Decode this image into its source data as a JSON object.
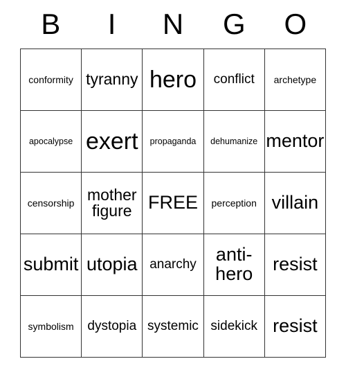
{
  "card": {
    "type": "bingo-card",
    "columns": 5,
    "rows": 5,
    "border_color": "#333333",
    "background_color": "#ffffff",
    "text_color": "#000000"
  },
  "header": {
    "letters": [
      "B",
      "I",
      "N",
      "G",
      "O"
    ]
  },
  "grid": {
    "cells": [
      {
        "text": "conformity",
        "size": "fs-s"
      },
      {
        "text": "tyranny",
        "size": "fs-l"
      },
      {
        "text": "hero",
        "size": "fs-xxl"
      },
      {
        "text": "conflict",
        "size": "fs-m"
      },
      {
        "text": "archetype",
        "size": "fs-s"
      },
      {
        "text": "apocalypse",
        "size": "fs-xs"
      },
      {
        "text": "exert",
        "size": "fs-xxl"
      },
      {
        "text": "propaganda",
        "size": "fs-xs"
      },
      {
        "text": "dehumanize",
        "size": "fs-xs"
      },
      {
        "text": "mentor",
        "size": "fs-xl"
      },
      {
        "text": "censorship",
        "size": "fs-s"
      },
      {
        "text": "mother\nfigure",
        "size": "fs-l"
      },
      {
        "text": "FREE",
        "size": "fs-xl"
      },
      {
        "text": "perception",
        "size": "fs-s"
      },
      {
        "text": "villain",
        "size": "fs-xl"
      },
      {
        "text": "submit",
        "size": "fs-xl"
      },
      {
        "text": "utopia",
        "size": "fs-xl"
      },
      {
        "text": "anarchy",
        "size": "fs-m"
      },
      {
        "text": "anti-\nhero",
        "size": "fs-xl"
      },
      {
        "text": "resist",
        "size": "fs-xl"
      },
      {
        "text": "symbolism",
        "size": "fs-s"
      },
      {
        "text": "dystopia",
        "size": "fs-m"
      },
      {
        "text": "systemic",
        "size": "fs-m"
      },
      {
        "text": "sidekick",
        "size": "fs-m"
      },
      {
        "text": "resist",
        "size": "fs-xl"
      }
    ]
  }
}
